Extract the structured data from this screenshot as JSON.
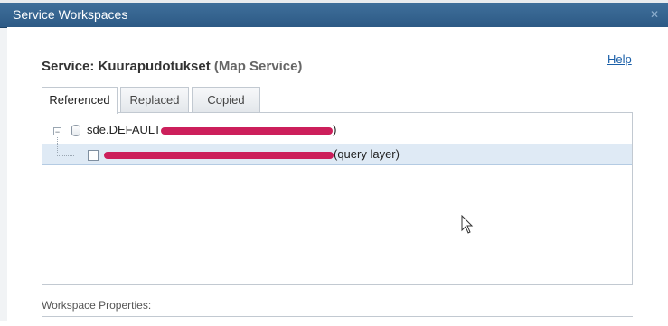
{
  "dialog": {
    "title": "Service Workspaces",
    "close_glyph": "✕"
  },
  "service": {
    "label": "Service:",
    "name": "Kuurapudotukset",
    "type": "(Map Service)"
  },
  "help_label": "Help",
  "tabs": [
    {
      "label": "Referenced",
      "active": true
    },
    {
      "label": "Replaced",
      "active": false
    },
    {
      "label": "Copied",
      "active": false
    }
  ],
  "tree": {
    "expander_glyph": "−",
    "connection_prefix": "sde.DEFAULT",
    "connection_suffix": ")",
    "child_suffix": "(query layer)",
    "redaction_color": "#cc1f5b"
  },
  "workspace_properties_label": "Workspace Properties:",
  "colors": {
    "titlebar": "#2d5a85",
    "link": "#1a5fa8",
    "selection": "#dfeaf5"
  },
  "icons": [
    "close-icon",
    "expander-minus-icon",
    "database-icon",
    "checkbox",
    "mouse-cursor-icon"
  ]
}
